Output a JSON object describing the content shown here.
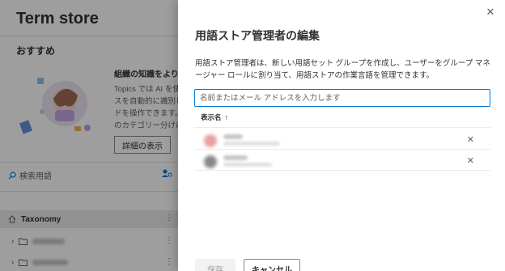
{
  "background": {
    "title": "Term store",
    "recommended_label": "おすすめ",
    "card": {
      "heading": "組織の知識をより適",
      "body_lines": [
        "Topics では AI を使用",
        "スを自動的に識別し",
        "ドを操作できます。",
        "のカテゴリー分けに"
      ],
      "detail_button": "詳細の表示"
    },
    "search_placeholder": "検索用語",
    "taxonomy_label": "Taxonomy",
    "more_glyph": "⋮"
  },
  "panel": {
    "title": "用語ストア管理者の編集",
    "description": "用語ストア管理者は、新しい用語セット グループを作成し、ユーザーをグループ マネージャー ロールに割り当て、用語ストアの作業言語を管理できます。",
    "input_placeholder": "名前またはメール アドレスを入力します",
    "column_header": "表示名",
    "sort_glyph": "↑",
    "close_glyph": "✕",
    "remove_glyph": "✕",
    "save_label": "保存",
    "cancel_label": "キャンセル"
  },
  "colors": {
    "accent": "#0078d4",
    "avatar_1": "#e8a0a0",
    "avatar_2": "#8a8886"
  }
}
